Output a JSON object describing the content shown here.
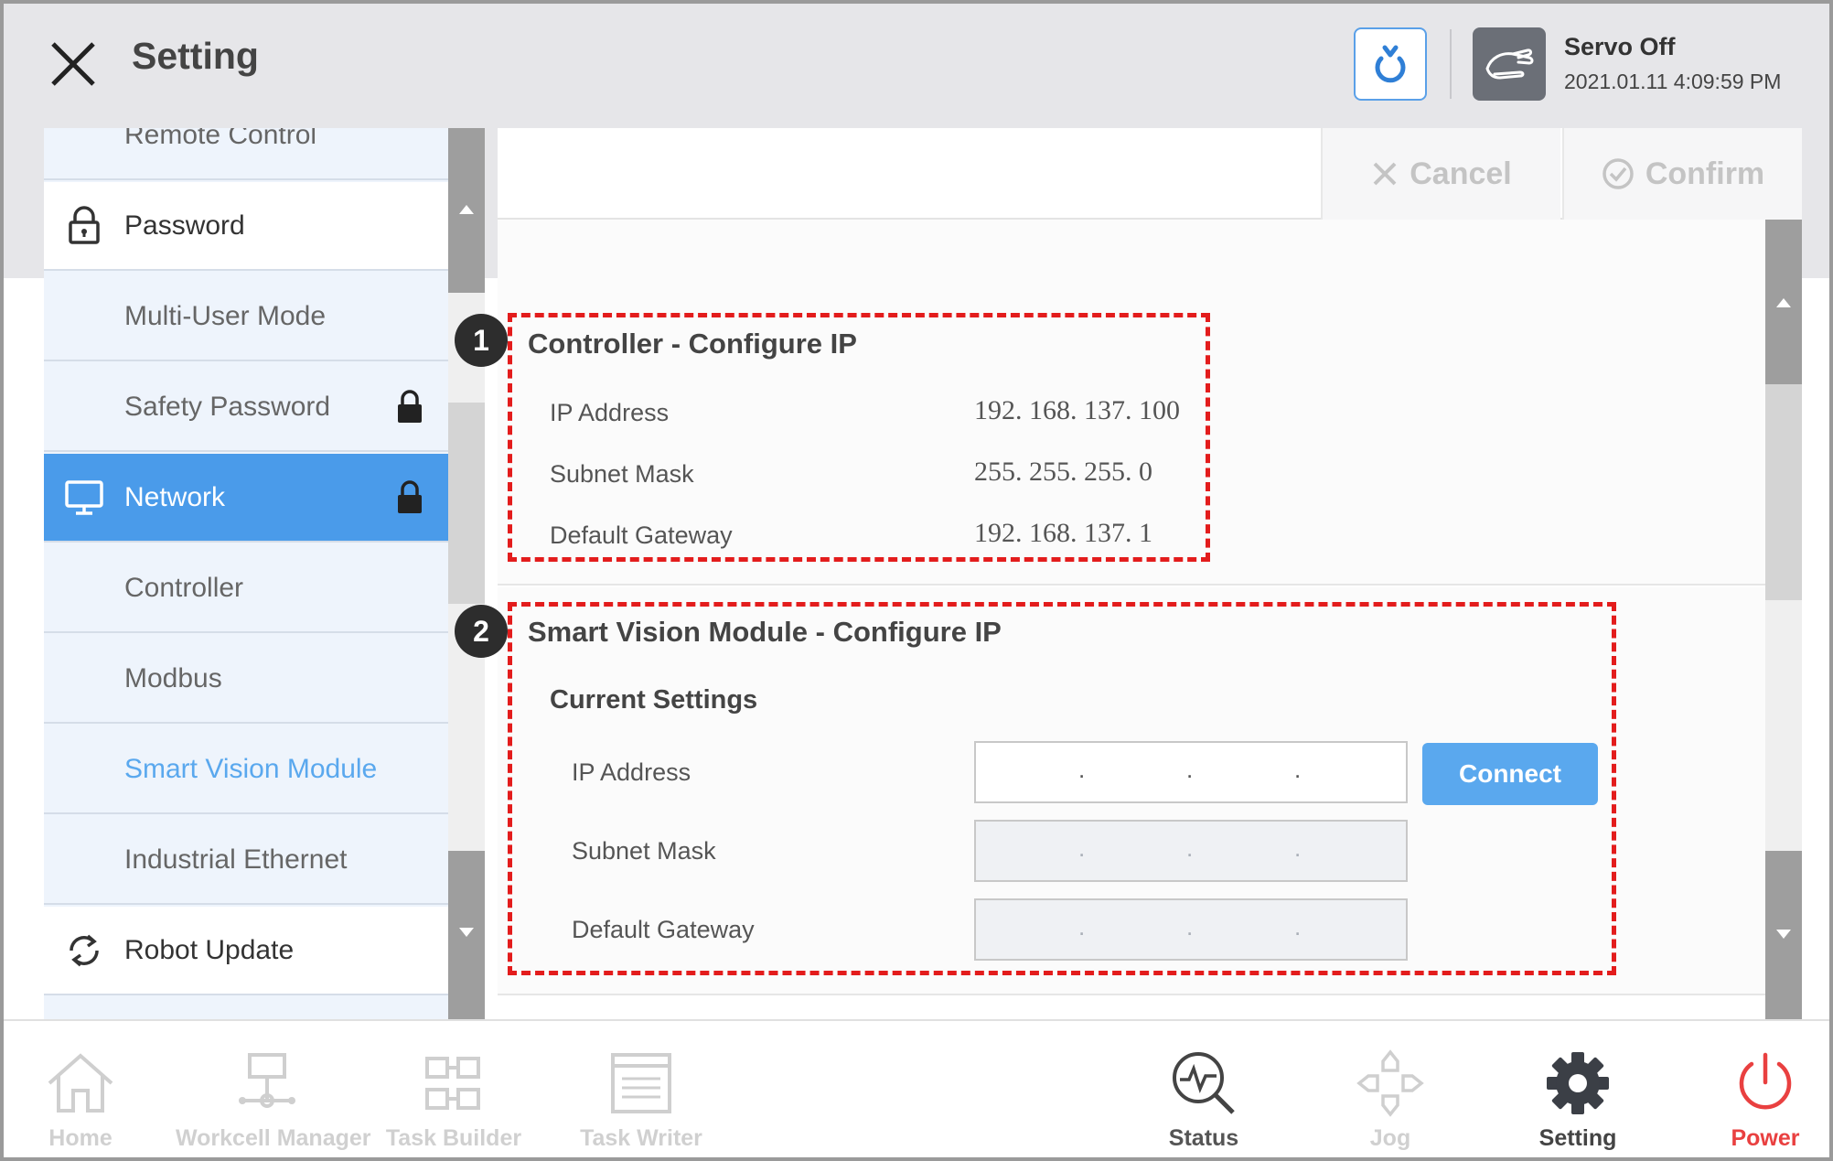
{
  "header": {
    "title": "Setting",
    "servo_status": "Servo Off",
    "datetime": "2021.01.11 4:09:59 PM"
  },
  "sidebar": {
    "items": [
      {
        "label": "Remote Control"
      },
      {
        "label": "Password",
        "icon": "lock-icon"
      },
      {
        "label": "Multi-User Mode"
      },
      {
        "label": "Safety Password",
        "locked": true
      },
      {
        "label": "Network",
        "icon": "monitor-icon",
        "locked": true,
        "selected": true
      },
      {
        "label": "Controller"
      },
      {
        "label": "Modbus"
      },
      {
        "label": "Smart Vision Module",
        "active": true
      },
      {
        "label": "Industrial Ethernet"
      },
      {
        "label": "Robot Update",
        "icon": "sync-icon"
      }
    ]
  },
  "toolbar": {
    "cancel_label": "Cancel",
    "confirm_label": "Confirm"
  },
  "controller_section": {
    "badge": "1",
    "title": "Controller - Configure IP",
    "rows": [
      {
        "label": "IP Address",
        "value": "192. 168. 137. 100"
      },
      {
        "label": "Subnet Mask",
        "value": "255. 255. 255. 0"
      },
      {
        "label": "Default Gateway",
        "value": "192. 168. 137. 1"
      }
    ]
  },
  "vision_section": {
    "badge": "2",
    "title": "Smart Vision Module - Configure IP",
    "subtitle": "Current Settings",
    "rows": [
      {
        "label": "IP Address",
        "dot": "."
      },
      {
        "label": "Subnet Mask",
        "dot": "."
      },
      {
        "label": "Default Gateway",
        "dot": "."
      }
    ],
    "connect_label": "Connect"
  },
  "bottom_nav": [
    {
      "label": "Home",
      "icon": "home-icon"
    },
    {
      "label": "Workcell Manager",
      "icon": "workcell-icon"
    },
    {
      "label": "Task Builder",
      "icon": "task-builder-icon"
    },
    {
      "label": "Task Writer",
      "icon": "task-writer-icon"
    },
    {
      "label": "Status",
      "icon": "status-icon"
    },
    {
      "label": "Jog",
      "icon": "jog-icon"
    },
    {
      "label": "Setting",
      "icon": "gear-icon"
    },
    {
      "label": "Power",
      "icon": "power-icon"
    }
  ],
  "colors": {
    "accent": "#4a9bea",
    "link": "#5aa8ee",
    "annotation": "#e31c1c",
    "power": "#e94040"
  }
}
